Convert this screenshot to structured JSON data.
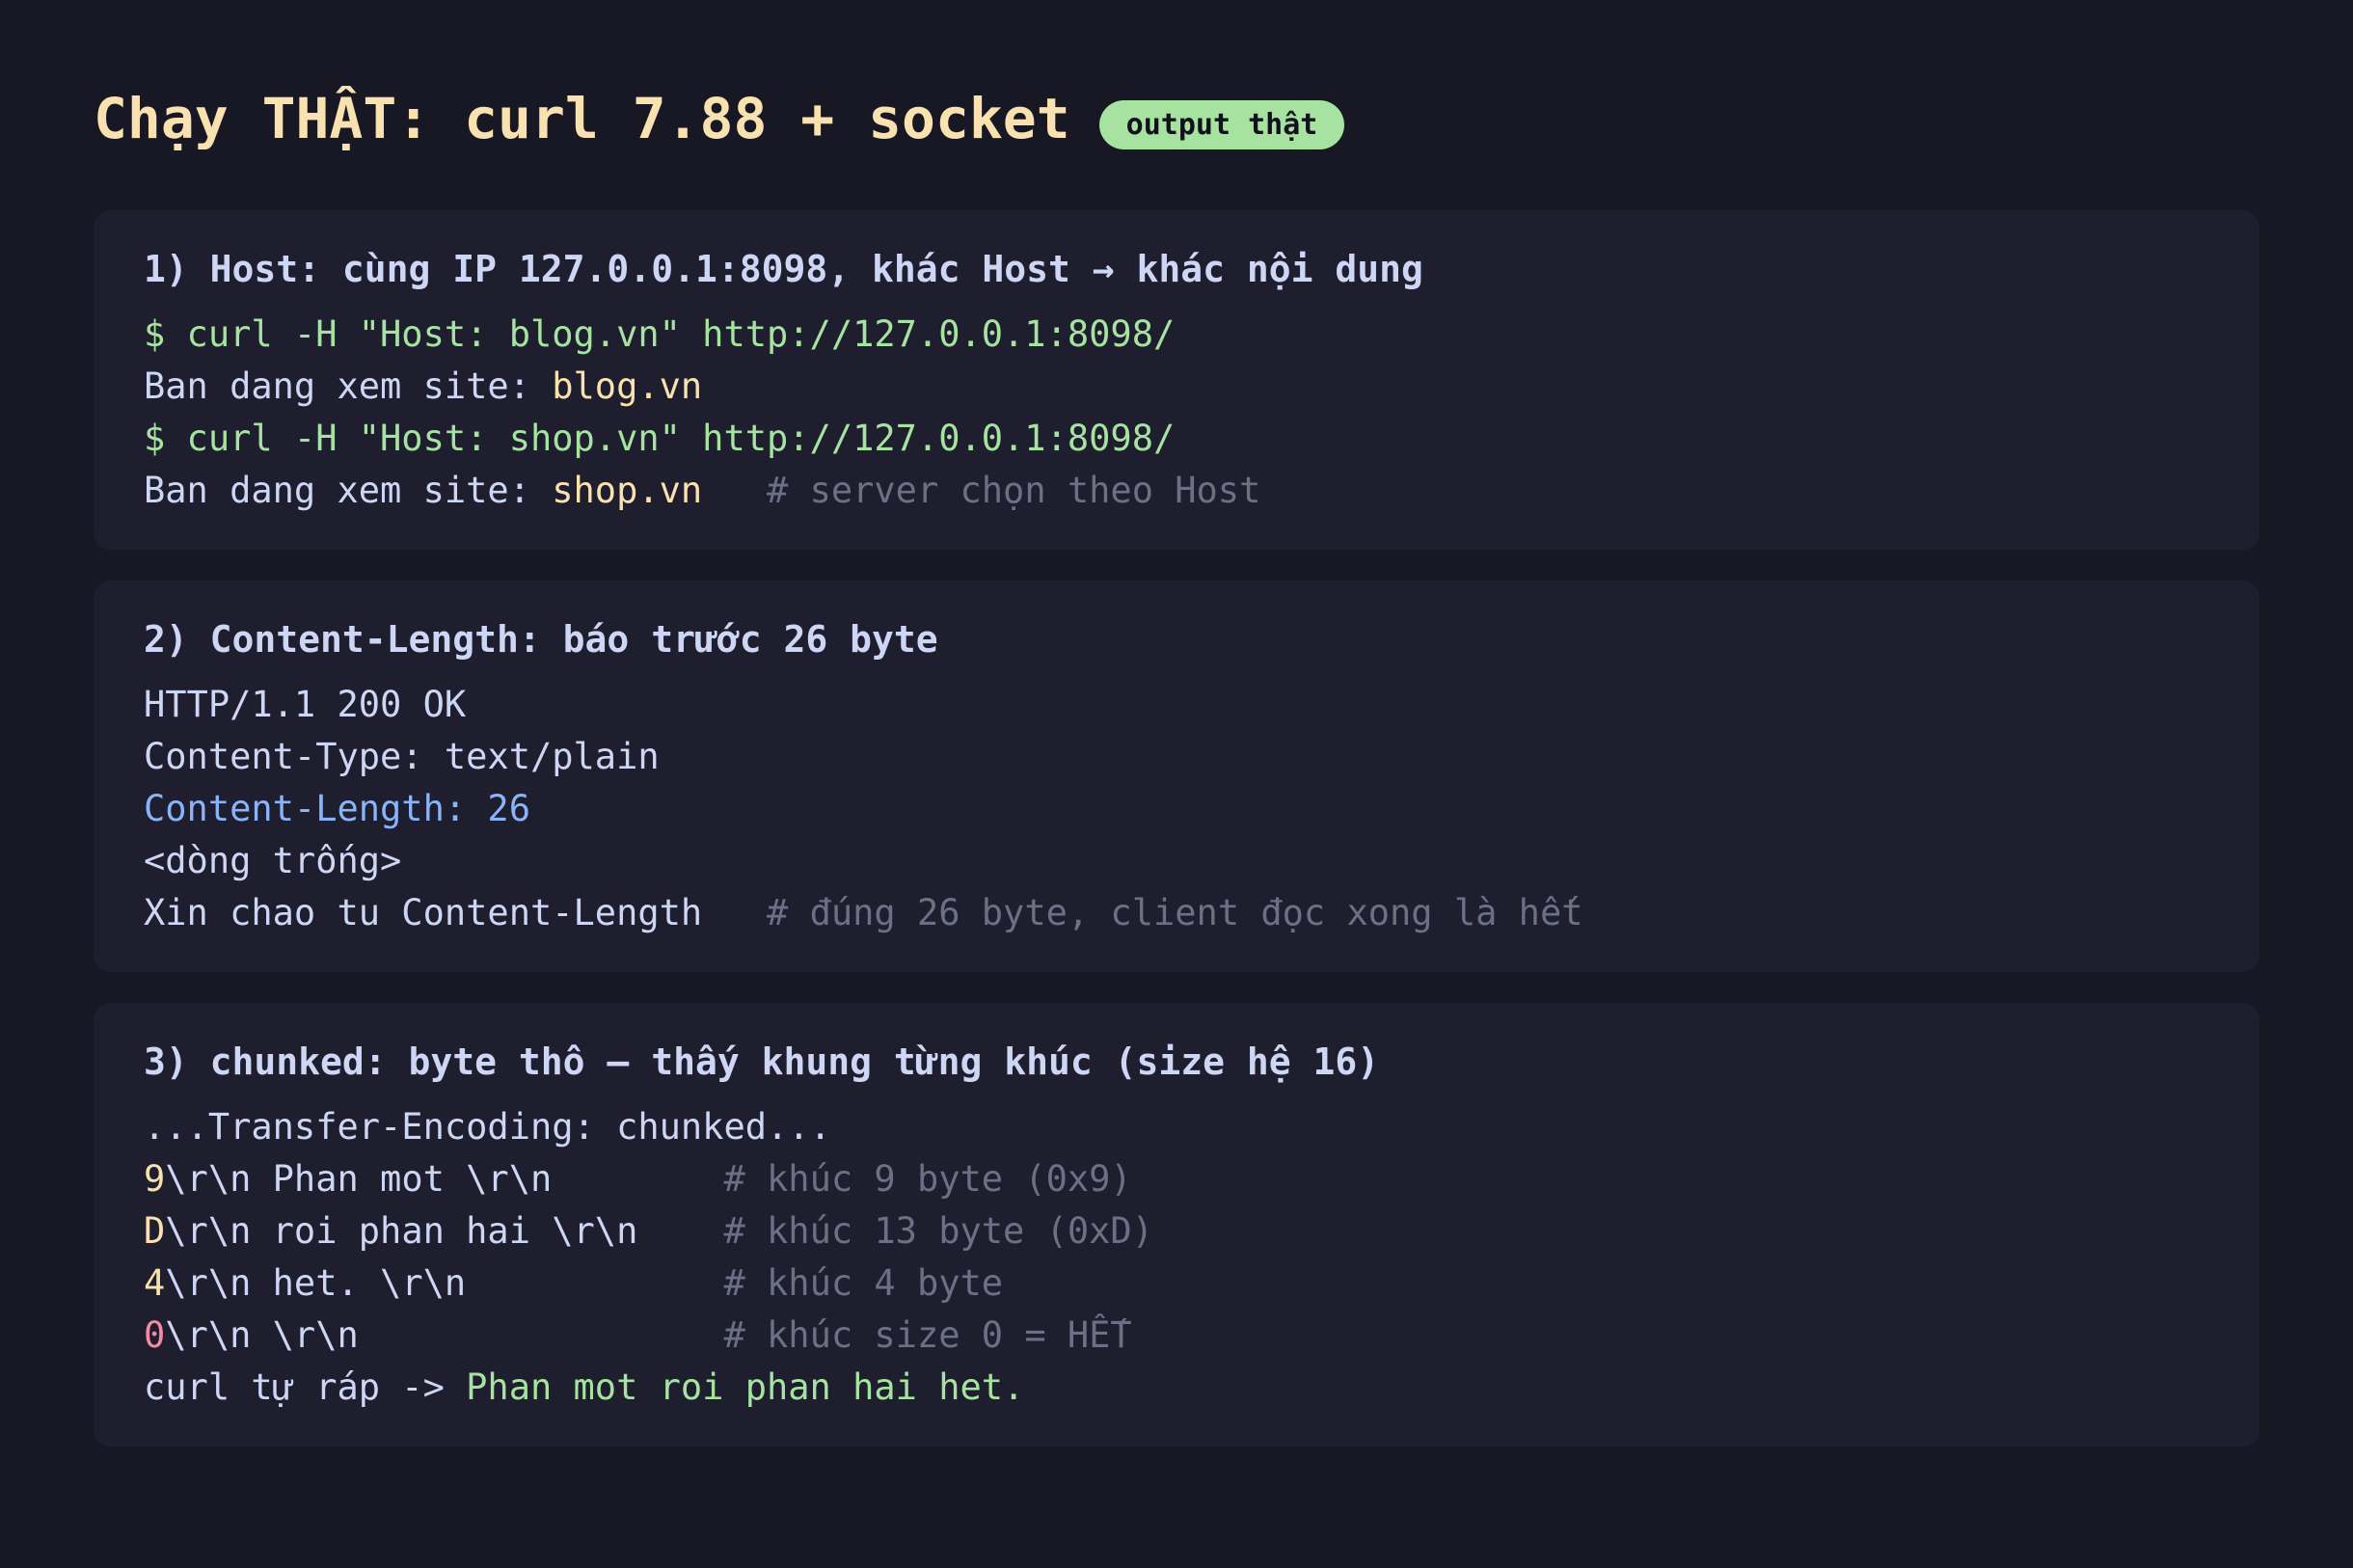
{
  "header": {
    "title": "Chạy THẬT: curl 7.88 + socket",
    "badge": "output thật"
  },
  "sections": [
    {
      "title": "1) Host: cùng IP 127.0.0.1:8098, khác Host → khác nội dung",
      "lines": [
        {
          "cmd": "$ curl -H \"Host: blog.vn\" http://127.0.0.1:8098/"
        },
        {
          "text": "Ban dang xem site: ",
          "value": "blog.vn"
        },
        {
          "cmd": "$ curl -H \"Host: shop.vn\" http://127.0.0.1:8098/"
        },
        {
          "text": "Ban dang xem site: ",
          "value": "shop.vn",
          "pad": "   ",
          "comment": "# server chọn theo Host"
        }
      ]
    },
    {
      "title": "2) Content-Length: báo trước 26 byte",
      "lines": [
        {
          "text": "HTTP/1.1 200 OK"
        },
        {
          "text": "Content-Type: text/plain"
        },
        {
          "highlight": "Content-Length: 26"
        },
        {
          "text": "<dòng trống>"
        },
        {
          "text": "Xin chao tu Content-Length",
          "pad": "   ",
          "comment": "# đúng 26 byte, client đọc xong là hết"
        }
      ]
    },
    {
      "title": "3) chunked: byte thô — thấy khung từng khúc (size hệ 16)",
      "lines": [
        {
          "text": "...Transfer-Encoding: chunked..."
        },
        {
          "size": "9",
          "text": "\\r\\n Phan mot \\r\\n",
          "pad": "        ",
          "comment": "# khúc 9 byte (0x9)"
        },
        {
          "size": "D",
          "text": "\\r\\n roi phan hai \\r\\n",
          "pad": "    ",
          "comment": "# khúc 13 byte (0xD)"
        },
        {
          "size": "4",
          "text": "\\r\\n het. \\r\\n",
          "pad": "            ",
          "comment": "# khúc 4 byte"
        },
        {
          "size": "0",
          "text": "\\r\\n \\r\\n",
          "pad": "                 ",
          "comment": "# khúc size 0 = HẾT"
        },
        {
          "text": "curl tự ráp -> ",
          "result": "Phan mot roi phan hai het."
        }
      ]
    }
  ],
  "colors": {
    "background": "#181825",
    "card": "#1e1e2e",
    "title": "#f9e2af",
    "badge": "#a6e3a1",
    "command": "#a6e3a1",
    "value": "#f9e2af",
    "highlight": "#89b4fa",
    "size_last": "#f38ba8",
    "comment": "#6c7086"
  }
}
